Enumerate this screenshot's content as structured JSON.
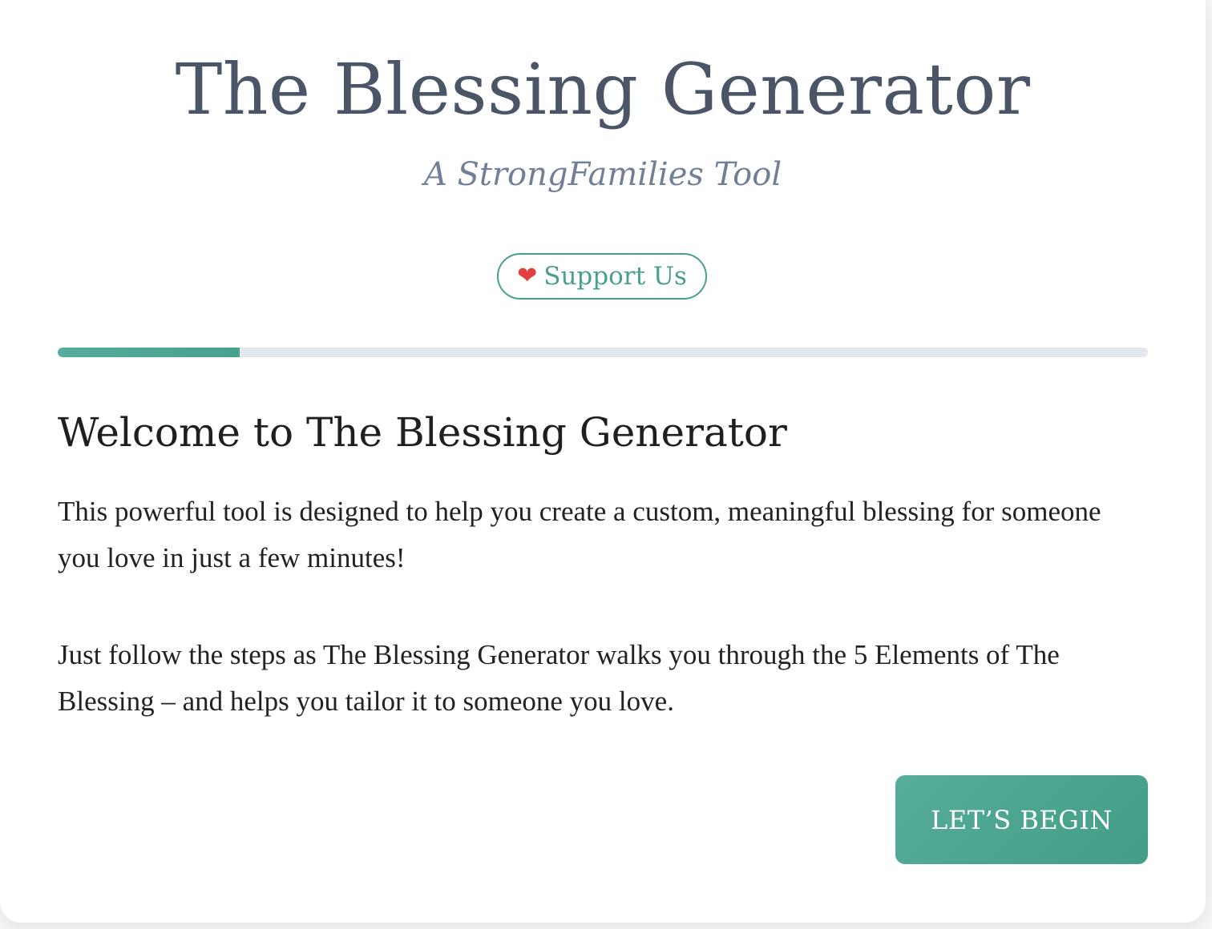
{
  "header": {
    "title": "The Blessing Generator",
    "subtitle": "A StrongFamilies Tool",
    "support_label": "Support Us",
    "support_icon": "heart-icon",
    "support_icon_glyph": "❤"
  },
  "progress": {
    "fraction": 0.167
  },
  "content": {
    "heading": "Welcome to The Blessing Generator",
    "paragraphs": [
      "This powerful tool is designed to help you create a custom, meaningful blessing for someone you love in just a few minutes!",
      "Just follow the steps as The Blessing Generator walks you through the 5 Elements of The Blessing – and helps you tailor it to someone you love."
    ]
  },
  "actions": {
    "begin_label": "LET’S BEGIN"
  },
  "colors": {
    "accent": "#4a9f8c",
    "title": "#4a5568",
    "subtitle": "#718096",
    "track": "#e2e8f0"
  }
}
